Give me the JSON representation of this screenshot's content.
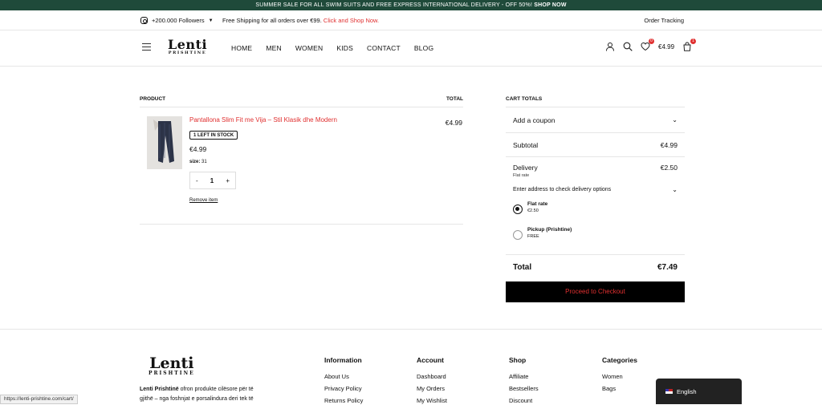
{
  "topbar": {
    "text": "SUMMER SALE FOR ALL SWIM SUITS AND FREE EXPRESS INTERNATIONAL DELIVERY - OFF 50%!",
    "cta": "SHOP NOW"
  },
  "infobar": {
    "followers": "+200.000 Followers",
    "shipping": "Free Shipping for all orders over €99.",
    "shipping_link": "Click and Shop Now.",
    "tracking": "Order Tracking"
  },
  "header": {
    "logo_main": "Lenti",
    "logo_sub": "PRISHTINE",
    "nav": [
      "HOME",
      "MEN",
      "WOMEN",
      "KIDS",
      "CONTACT",
      "BLOG"
    ],
    "wishlist_count": "0",
    "cart_amount": "€4.99",
    "cart_count": "1"
  },
  "cart": {
    "col_product": "PRODUCT",
    "col_total": "TOTAL",
    "item": {
      "name": "Pantallona Slim Fit me Vija – Stil Klasik dhe Modern",
      "stock": "1 LEFT IN STOCK",
      "price": "€4.99",
      "size_label": "size:",
      "size": "31",
      "qty": "1",
      "minus": "-",
      "plus": "+",
      "remove": "Remove item",
      "total": "€4.99"
    }
  },
  "totals": {
    "title": "CART TOTALS",
    "coupon": "Add a coupon",
    "subtotal_label": "Subtotal",
    "subtotal": "€4.99",
    "delivery_label": "Delivery",
    "delivery_method": "Flat rate",
    "delivery": "€2.50",
    "enter_address": "Enter address to check delivery options",
    "options": [
      {
        "name": "Flat rate",
        "price": "€2.50",
        "selected": true
      },
      {
        "name": "Pickup (Prishtine)",
        "price": "FREE",
        "selected": false
      }
    ],
    "total_label": "Total",
    "total": "€7.49",
    "checkout": "Proceed to Checkout"
  },
  "footer": {
    "logo_main": "Lenti",
    "logo_sub": "PRISHTINE",
    "desc_brand": "Lenti Prishtinë",
    "desc_rest": "ofron produkte cilësore për të gjithë – nga foshnjat e porsalindura deri tek të",
    "columns": [
      {
        "title": "Information",
        "links": [
          "About Us",
          "Privacy Policy",
          "Returns Policy"
        ]
      },
      {
        "title": "Account",
        "links": [
          "Dashboard",
          "My Orders",
          "My Wishlist"
        ]
      },
      {
        "title": "Shop",
        "links": [
          "Affiliate",
          "Bestsellers",
          "Discount"
        ]
      },
      {
        "title": "Categories",
        "links": [
          "Women",
          "Bags"
        ]
      }
    ]
  },
  "status_url": "https://lenti-prishtine.com/cart/",
  "language": "English"
}
